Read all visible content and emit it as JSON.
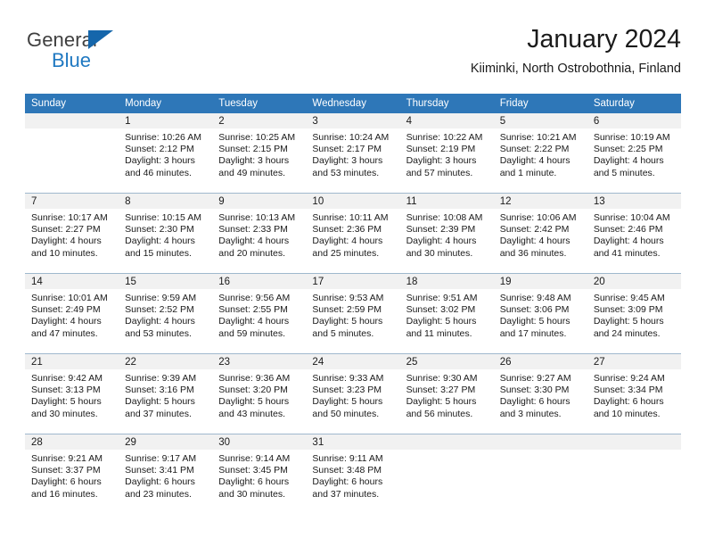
{
  "brand": {
    "name_part1": "General",
    "name_part2": "Blue",
    "triangle_color": "#1566ab",
    "blue_color": "#1f78c1"
  },
  "header": {
    "title": "January 2024",
    "subtitle": "Kiiminki, North Ostrobothnia, Finland"
  },
  "theme": {
    "header_bg": "#2e77b8",
    "daynum_bg": "#f1f1f1",
    "row_divider": "#9fb8cd"
  },
  "weekdays": [
    "Sunday",
    "Monday",
    "Tuesday",
    "Wednesday",
    "Thursday",
    "Friday",
    "Saturday"
  ],
  "weeks": [
    [
      {
        "day": "",
        "sunrise": "",
        "sunset": "",
        "daylight_line1": "",
        "daylight_line2": "",
        "empty": true
      },
      {
        "day": "1",
        "sunrise": "Sunrise: 10:26 AM",
        "sunset": "Sunset: 2:12 PM",
        "daylight_line1": "Daylight: 3 hours",
        "daylight_line2": "and 46 minutes.",
        "empty": false
      },
      {
        "day": "2",
        "sunrise": "Sunrise: 10:25 AM",
        "sunset": "Sunset: 2:15 PM",
        "daylight_line1": "Daylight: 3 hours",
        "daylight_line2": "and 49 minutes.",
        "empty": false
      },
      {
        "day": "3",
        "sunrise": "Sunrise: 10:24 AM",
        "sunset": "Sunset: 2:17 PM",
        "daylight_line1": "Daylight: 3 hours",
        "daylight_line2": "and 53 minutes.",
        "empty": false
      },
      {
        "day": "4",
        "sunrise": "Sunrise: 10:22 AM",
        "sunset": "Sunset: 2:19 PM",
        "daylight_line1": "Daylight: 3 hours",
        "daylight_line2": "and 57 minutes.",
        "empty": false
      },
      {
        "day": "5",
        "sunrise": "Sunrise: 10:21 AM",
        "sunset": "Sunset: 2:22 PM",
        "daylight_line1": "Daylight: 4 hours",
        "daylight_line2": "and 1 minute.",
        "empty": false
      },
      {
        "day": "6",
        "sunrise": "Sunrise: 10:19 AM",
        "sunset": "Sunset: 2:25 PM",
        "daylight_line1": "Daylight: 4 hours",
        "daylight_line2": "and 5 minutes.",
        "empty": false
      }
    ],
    [
      {
        "day": "7",
        "sunrise": "Sunrise: 10:17 AM",
        "sunset": "Sunset: 2:27 PM",
        "daylight_line1": "Daylight: 4 hours",
        "daylight_line2": "and 10 minutes.",
        "empty": false
      },
      {
        "day": "8",
        "sunrise": "Sunrise: 10:15 AM",
        "sunset": "Sunset: 2:30 PM",
        "daylight_line1": "Daylight: 4 hours",
        "daylight_line2": "and 15 minutes.",
        "empty": false
      },
      {
        "day": "9",
        "sunrise": "Sunrise: 10:13 AM",
        "sunset": "Sunset: 2:33 PM",
        "daylight_line1": "Daylight: 4 hours",
        "daylight_line2": "and 20 minutes.",
        "empty": false
      },
      {
        "day": "10",
        "sunrise": "Sunrise: 10:11 AM",
        "sunset": "Sunset: 2:36 PM",
        "daylight_line1": "Daylight: 4 hours",
        "daylight_line2": "and 25 minutes.",
        "empty": false
      },
      {
        "day": "11",
        "sunrise": "Sunrise: 10:08 AM",
        "sunset": "Sunset: 2:39 PM",
        "daylight_line1": "Daylight: 4 hours",
        "daylight_line2": "and 30 minutes.",
        "empty": false
      },
      {
        "day": "12",
        "sunrise": "Sunrise: 10:06 AM",
        "sunset": "Sunset: 2:42 PM",
        "daylight_line1": "Daylight: 4 hours",
        "daylight_line2": "and 36 minutes.",
        "empty": false
      },
      {
        "day": "13",
        "sunrise": "Sunrise: 10:04 AM",
        "sunset": "Sunset: 2:46 PM",
        "daylight_line1": "Daylight: 4 hours",
        "daylight_line2": "and 41 minutes.",
        "empty": false
      }
    ],
    [
      {
        "day": "14",
        "sunrise": "Sunrise: 10:01 AM",
        "sunset": "Sunset: 2:49 PM",
        "daylight_line1": "Daylight: 4 hours",
        "daylight_line2": "and 47 minutes.",
        "empty": false
      },
      {
        "day": "15",
        "sunrise": "Sunrise: 9:59 AM",
        "sunset": "Sunset: 2:52 PM",
        "daylight_line1": "Daylight: 4 hours",
        "daylight_line2": "and 53 minutes.",
        "empty": false
      },
      {
        "day": "16",
        "sunrise": "Sunrise: 9:56 AM",
        "sunset": "Sunset: 2:55 PM",
        "daylight_line1": "Daylight: 4 hours",
        "daylight_line2": "and 59 minutes.",
        "empty": false
      },
      {
        "day": "17",
        "sunrise": "Sunrise: 9:53 AM",
        "sunset": "Sunset: 2:59 PM",
        "daylight_line1": "Daylight: 5 hours",
        "daylight_line2": "and 5 minutes.",
        "empty": false
      },
      {
        "day": "18",
        "sunrise": "Sunrise: 9:51 AM",
        "sunset": "Sunset: 3:02 PM",
        "daylight_line1": "Daylight: 5 hours",
        "daylight_line2": "and 11 minutes.",
        "empty": false
      },
      {
        "day": "19",
        "sunrise": "Sunrise: 9:48 AM",
        "sunset": "Sunset: 3:06 PM",
        "daylight_line1": "Daylight: 5 hours",
        "daylight_line2": "and 17 minutes.",
        "empty": false
      },
      {
        "day": "20",
        "sunrise": "Sunrise: 9:45 AM",
        "sunset": "Sunset: 3:09 PM",
        "daylight_line1": "Daylight: 5 hours",
        "daylight_line2": "and 24 minutes.",
        "empty": false
      }
    ],
    [
      {
        "day": "21",
        "sunrise": "Sunrise: 9:42 AM",
        "sunset": "Sunset: 3:13 PM",
        "daylight_line1": "Daylight: 5 hours",
        "daylight_line2": "and 30 minutes.",
        "empty": false
      },
      {
        "day": "22",
        "sunrise": "Sunrise: 9:39 AM",
        "sunset": "Sunset: 3:16 PM",
        "daylight_line1": "Daylight: 5 hours",
        "daylight_line2": "and 37 minutes.",
        "empty": false
      },
      {
        "day": "23",
        "sunrise": "Sunrise: 9:36 AM",
        "sunset": "Sunset: 3:20 PM",
        "daylight_line1": "Daylight: 5 hours",
        "daylight_line2": "and 43 minutes.",
        "empty": false
      },
      {
        "day": "24",
        "sunrise": "Sunrise: 9:33 AM",
        "sunset": "Sunset: 3:23 PM",
        "daylight_line1": "Daylight: 5 hours",
        "daylight_line2": "and 50 minutes.",
        "empty": false
      },
      {
        "day": "25",
        "sunrise": "Sunrise: 9:30 AM",
        "sunset": "Sunset: 3:27 PM",
        "daylight_line1": "Daylight: 5 hours",
        "daylight_line2": "and 56 minutes.",
        "empty": false
      },
      {
        "day": "26",
        "sunrise": "Sunrise: 9:27 AM",
        "sunset": "Sunset: 3:30 PM",
        "daylight_line1": "Daylight: 6 hours",
        "daylight_line2": "and 3 minutes.",
        "empty": false
      },
      {
        "day": "27",
        "sunrise": "Sunrise: 9:24 AM",
        "sunset": "Sunset: 3:34 PM",
        "daylight_line1": "Daylight: 6 hours",
        "daylight_line2": "and 10 minutes.",
        "empty": false
      }
    ],
    [
      {
        "day": "28",
        "sunrise": "Sunrise: 9:21 AM",
        "sunset": "Sunset: 3:37 PM",
        "daylight_line1": "Daylight: 6 hours",
        "daylight_line2": "and 16 minutes.",
        "empty": false
      },
      {
        "day": "29",
        "sunrise": "Sunrise: 9:17 AM",
        "sunset": "Sunset: 3:41 PM",
        "daylight_line1": "Daylight: 6 hours",
        "daylight_line2": "and 23 minutes.",
        "empty": false
      },
      {
        "day": "30",
        "sunrise": "Sunrise: 9:14 AM",
        "sunset": "Sunset: 3:45 PM",
        "daylight_line1": "Daylight: 6 hours",
        "daylight_line2": "and 30 minutes.",
        "empty": false
      },
      {
        "day": "31",
        "sunrise": "Sunrise: 9:11 AM",
        "sunset": "Sunset: 3:48 PM",
        "daylight_line1": "Daylight: 6 hours",
        "daylight_line2": "and 37 minutes.",
        "empty": false
      },
      {
        "day": "",
        "sunrise": "",
        "sunset": "",
        "daylight_line1": "",
        "daylight_line2": "",
        "empty": true
      },
      {
        "day": "",
        "sunrise": "",
        "sunset": "",
        "daylight_line1": "",
        "daylight_line2": "",
        "empty": true
      },
      {
        "day": "",
        "sunrise": "",
        "sunset": "",
        "daylight_line1": "",
        "daylight_line2": "",
        "empty": true
      }
    ]
  ]
}
